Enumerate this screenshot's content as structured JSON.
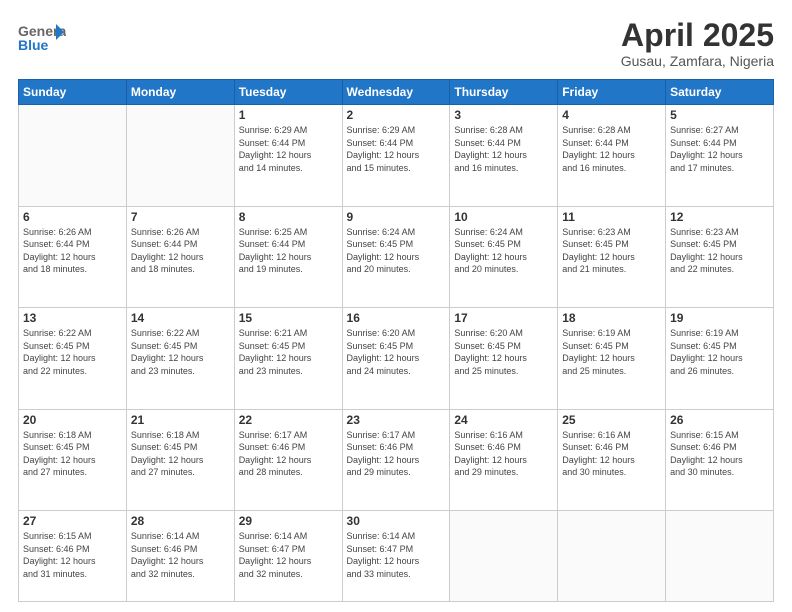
{
  "logo": {
    "general": "General",
    "blue": "Blue"
  },
  "title": "April 2025",
  "subtitle": "Gusau, Zamfara, Nigeria",
  "days_of_week": [
    "Sunday",
    "Monday",
    "Tuesday",
    "Wednesday",
    "Thursday",
    "Friday",
    "Saturday"
  ],
  "weeks": [
    [
      {
        "day": "",
        "info": ""
      },
      {
        "day": "",
        "info": ""
      },
      {
        "day": "1",
        "sunrise": "6:29 AM",
        "sunset": "6:44 PM",
        "daylight": "12 hours and 14 minutes."
      },
      {
        "day": "2",
        "sunrise": "6:29 AM",
        "sunset": "6:44 PM",
        "daylight": "12 hours and 15 minutes."
      },
      {
        "day": "3",
        "sunrise": "6:28 AM",
        "sunset": "6:44 PM",
        "daylight": "12 hours and 16 minutes."
      },
      {
        "day": "4",
        "sunrise": "6:28 AM",
        "sunset": "6:44 PM",
        "daylight": "12 hours and 16 minutes."
      },
      {
        "day": "5",
        "sunrise": "6:27 AM",
        "sunset": "6:44 PM",
        "daylight": "12 hours and 17 minutes."
      }
    ],
    [
      {
        "day": "6",
        "sunrise": "6:26 AM",
        "sunset": "6:44 PM",
        "daylight": "12 hours and 18 minutes."
      },
      {
        "day": "7",
        "sunrise": "6:26 AM",
        "sunset": "6:44 PM",
        "daylight": "12 hours and 18 minutes."
      },
      {
        "day": "8",
        "sunrise": "6:25 AM",
        "sunset": "6:44 PM",
        "daylight": "12 hours and 19 minutes."
      },
      {
        "day": "9",
        "sunrise": "6:24 AM",
        "sunset": "6:45 PM",
        "daylight": "12 hours and 20 minutes."
      },
      {
        "day": "10",
        "sunrise": "6:24 AM",
        "sunset": "6:45 PM",
        "daylight": "12 hours and 20 minutes."
      },
      {
        "day": "11",
        "sunrise": "6:23 AM",
        "sunset": "6:45 PM",
        "daylight": "12 hours and 21 minutes."
      },
      {
        "day": "12",
        "sunrise": "6:23 AM",
        "sunset": "6:45 PM",
        "daylight": "12 hours and 22 minutes."
      }
    ],
    [
      {
        "day": "13",
        "sunrise": "6:22 AM",
        "sunset": "6:45 PM",
        "daylight": "12 hours and 22 minutes."
      },
      {
        "day": "14",
        "sunrise": "6:22 AM",
        "sunset": "6:45 PM",
        "daylight": "12 hours and 23 minutes."
      },
      {
        "day": "15",
        "sunrise": "6:21 AM",
        "sunset": "6:45 PM",
        "daylight": "12 hours and 23 minutes."
      },
      {
        "day": "16",
        "sunrise": "6:20 AM",
        "sunset": "6:45 PM",
        "daylight": "12 hours and 24 minutes."
      },
      {
        "day": "17",
        "sunrise": "6:20 AM",
        "sunset": "6:45 PM",
        "daylight": "12 hours and 25 minutes."
      },
      {
        "day": "18",
        "sunrise": "6:19 AM",
        "sunset": "6:45 PM",
        "daylight": "12 hours and 25 minutes."
      },
      {
        "day": "19",
        "sunrise": "6:19 AM",
        "sunset": "6:45 PM",
        "daylight": "12 hours and 26 minutes."
      }
    ],
    [
      {
        "day": "20",
        "sunrise": "6:18 AM",
        "sunset": "6:45 PM",
        "daylight": "12 hours and 27 minutes."
      },
      {
        "day": "21",
        "sunrise": "6:18 AM",
        "sunset": "6:45 PM",
        "daylight": "12 hours and 27 minutes."
      },
      {
        "day": "22",
        "sunrise": "6:17 AM",
        "sunset": "6:46 PM",
        "daylight": "12 hours and 28 minutes."
      },
      {
        "day": "23",
        "sunrise": "6:17 AM",
        "sunset": "6:46 PM",
        "daylight": "12 hours and 29 minutes."
      },
      {
        "day": "24",
        "sunrise": "6:16 AM",
        "sunset": "6:46 PM",
        "daylight": "12 hours and 29 minutes."
      },
      {
        "day": "25",
        "sunrise": "6:16 AM",
        "sunset": "6:46 PM",
        "daylight": "12 hours and 30 minutes."
      },
      {
        "day": "26",
        "sunrise": "6:15 AM",
        "sunset": "6:46 PM",
        "daylight": "12 hours and 30 minutes."
      }
    ],
    [
      {
        "day": "27",
        "sunrise": "6:15 AM",
        "sunset": "6:46 PM",
        "daylight": "12 hours and 31 minutes."
      },
      {
        "day": "28",
        "sunrise": "6:14 AM",
        "sunset": "6:46 PM",
        "daylight": "12 hours and 32 minutes."
      },
      {
        "day": "29",
        "sunrise": "6:14 AM",
        "sunset": "6:47 PM",
        "daylight": "12 hours and 32 minutes."
      },
      {
        "day": "30",
        "sunrise": "6:14 AM",
        "sunset": "6:47 PM",
        "daylight": "12 hours and 33 minutes."
      },
      {
        "day": "",
        "info": ""
      },
      {
        "day": "",
        "info": ""
      },
      {
        "day": "",
        "info": ""
      }
    ]
  ]
}
